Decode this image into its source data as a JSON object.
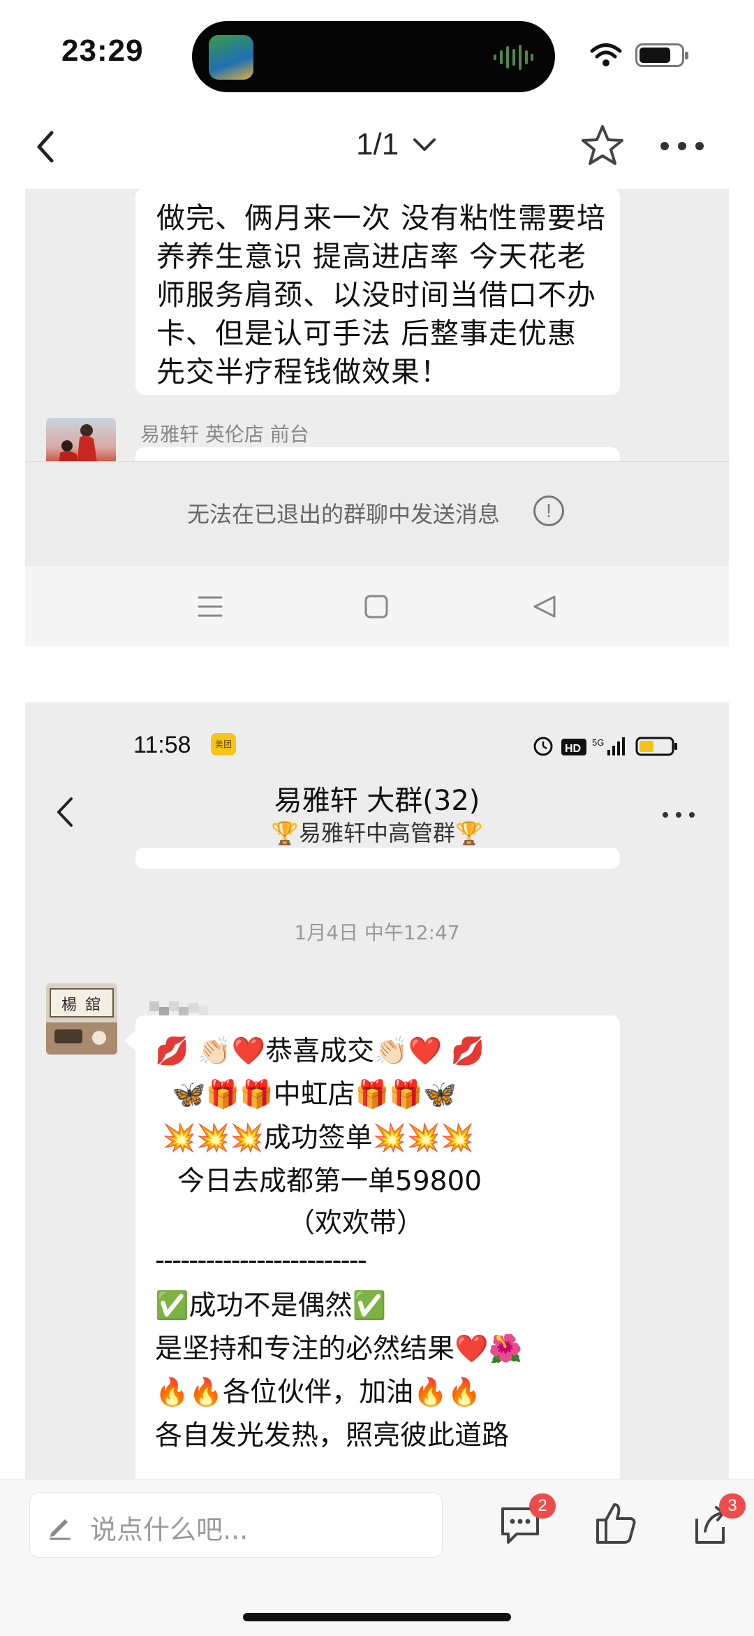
{
  "status_bar": {
    "time": "23:29"
  },
  "nav": {
    "pager": "1/1"
  },
  "screenshot1": {
    "message_lines": [
      "做完、俩月来一次 没有粘性需要培",
      "养养生意识 提高进店率  今天花老",
      "师服务肩颈、以没时间当借口不办",
      "卡、但是认可手法  后整事走优惠",
      "先交半疗程钱做效果！"
    ],
    "sender": "易雅轩 英伦店 前台",
    "notice": "无法在已退出的群聊中发送消息",
    "notice_icon": "!"
  },
  "screenshot2": {
    "time": "11:58",
    "app_badge": "美团",
    "status_text": "HD",
    "title": "易雅轩 大群(32)",
    "subtitle": "🏆易雅轩中高管群🏆",
    "date": "1月4日 中午12:47",
    "message_lines": [
      "💋 👏🏻❤️恭喜成交👏🏻❤️ 💋",
      "🦋🎁🎁中虹店🎁🎁🦋",
      "💥💥💥成功签单💥💥💥",
      "今日去成都第一单59800",
      "（欢欢带）",
      "-------------------------",
      "✅成功不是偶然✅",
      "是坚持和专注的必然结果❤️🌺",
      "🔥🔥各位伙伴，加油🔥🔥",
      "各自发光发热，照亮彼此道路"
    ]
  },
  "bottom_bar": {
    "comment_placeholder": "说点什么吧...",
    "comment_count": "2",
    "share_count": "3"
  },
  "colors": {
    "chat_bg": "#ededed",
    "bubble": "#ffffff",
    "badge": "#ee4b4b"
  },
  "icons": [
    "back-icon",
    "chevron-down-icon",
    "star-icon",
    "more-icon",
    "menu-icon",
    "square-icon",
    "triangle-back-icon",
    "pen-icon",
    "comment-icon",
    "thumbs-up-icon",
    "share-icon"
  ]
}
